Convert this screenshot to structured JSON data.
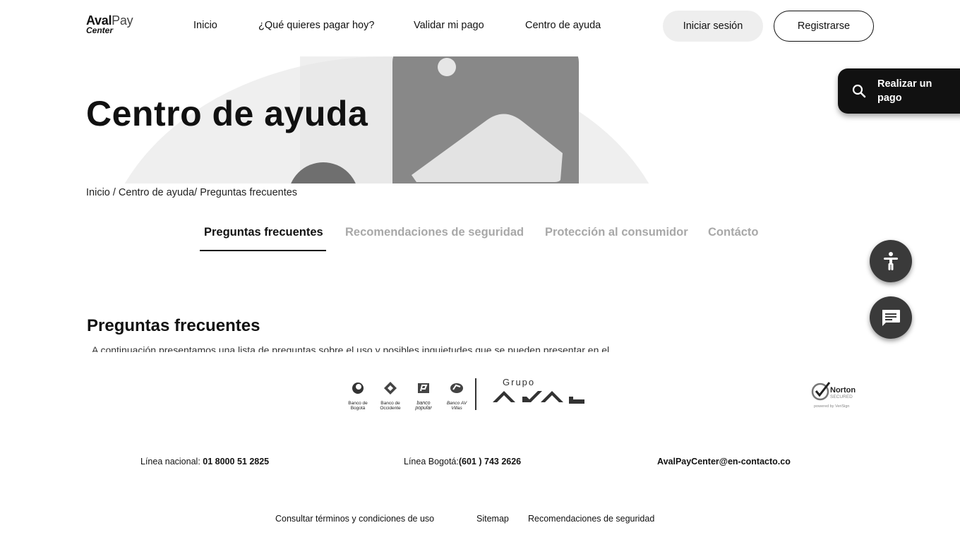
{
  "header": {
    "logo": {
      "line1_bold": "Aval",
      "line1_light": "Pay",
      "line2": "Center"
    },
    "nav": [
      "Inicio",
      "¿Qué quieres pagar hoy?",
      "Validar mi pago",
      "Centro de ayuda"
    ],
    "login_label": "Iniciar sesión",
    "register_label": "Registrarse"
  },
  "hero": {
    "title": "Centro de ayuda"
  },
  "float_pay": {
    "label": "Realizar un pago",
    "icon": "search-icon"
  },
  "breadcrumb": "Inicio / Centro de ayuda/ Preguntas frecuentes",
  "tabs": [
    {
      "label": "Preguntas frecuentes",
      "active": true
    },
    {
      "label": "Recomendaciones de seguridad",
      "active": false
    },
    {
      "label": "Protección al consumidor",
      "active": false
    },
    {
      "label": "Contácto",
      "active": false
    }
  ],
  "floating_buttons": {
    "accessibility_icon": "accessibility-icon",
    "chat_icon": "chat-icon"
  },
  "section": {
    "title": "Preguntas frecuentes",
    "intro": "A continuación presentamos una lista de preguntas sobre el uso y posibles inquietudes que se pueden presentar en el"
  },
  "banks": [
    {
      "name": "Banco de Bogotá"
    },
    {
      "name": "Banco de Occidente"
    },
    {
      "name": "banco popular"
    },
    {
      "name": "Banco AV Villas"
    }
  ],
  "group": {
    "label": "Grupo"
  },
  "norton": {
    "name": "Norton",
    "secured": "SECURED",
    "powered": "powered by VeriSign"
  },
  "contact": {
    "national_label": "Línea nacional:",
    "national_value": "01 8000 51 2825",
    "bogota_label": "Línea Bogotá:",
    "bogota_value": "(601 ) 743 2626",
    "email": "AvalPayCenter@en-contacto.co"
  },
  "footer_links": [
    "Consultar  términos y condiciones de uso",
    "Sitemap",
    "Recomendaciones de seguridad"
  ],
  "colors": {
    "primary": "#111111",
    "muted_tab": "#a8a8a8",
    "login_bg": "#eeeeee",
    "hero_shape": "#efefef"
  }
}
